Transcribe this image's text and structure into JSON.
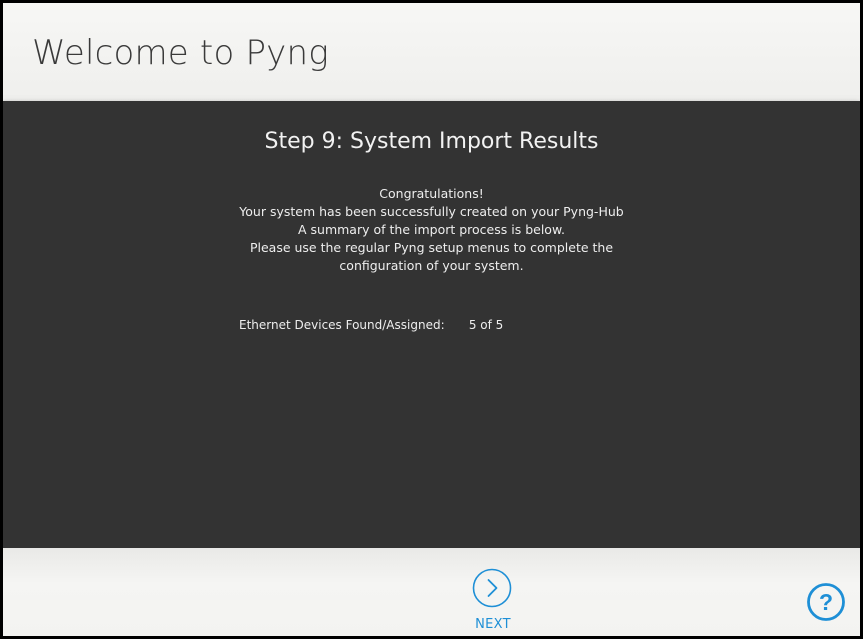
{
  "header": {
    "title": "Welcome to Pyng"
  },
  "wizard": {
    "step_title": "Step 9: System Import Results",
    "message_lines": [
      "Congratulations!",
      "Your system has been successfully created on your Pyng-Hub",
      "A summary of the import process is below.",
      "Please use the regular Pyng setup menus to complete the",
      "configuration of your system."
    ],
    "results": [
      {
        "label": "Ethernet Devices Found/Assigned:",
        "value": "5 of 5"
      }
    ]
  },
  "footer": {
    "next_label": "NEXT",
    "next_icon": "chevron-right-circle-icon",
    "help_icon": "question-circle-icon",
    "help_glyph": "?"
  },
  "colors": {
    "accent": "#1e8fd6",
    "panel_background": "#333333",
    "page_background": "#f3f3f1",
    "title_text": "#3a3a3a"
  }
}
